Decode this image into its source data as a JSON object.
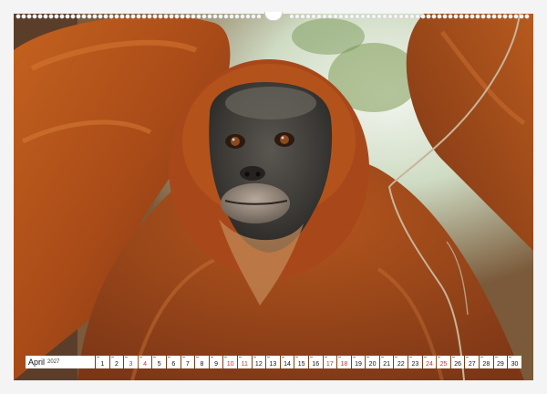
{
  "calendar": {
    "month": "April",
    "year": "2027",
    "days": [
      "1",
      "2",
      "3",
      "4",
      "5",
      "6",
      "7",
      "8",
      "9",
      "10",
      "11",
      "12",
      "13",
      "14",
      "15",
      "16",
      "17",
      "18",
      "19",
      "20",
      "21",
      "22",
      "23",
      "24",
      "25",
      "26",
      "27",
      "28",
      "29",
      "30"
    ],
    "highlighted_days": [
      "3",
      "4",
      "10",
      "11",
      "17",
      "18",
      "24",
      "25"
    ],
    "accent_color": "#d0322b"
  }
}
